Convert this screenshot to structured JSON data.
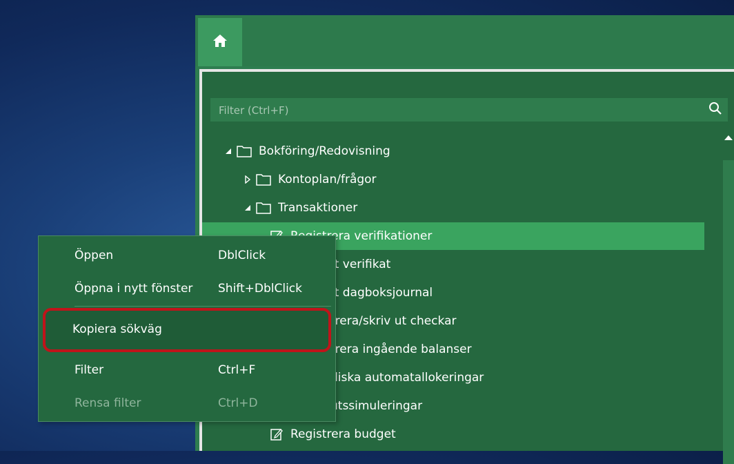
{
  "filter": {
    "placeholder": "Filter (Ctrl+F)"
  },
  "tree": [
    {
      "label": "Bokföring/Redovisning",
      "expanded": true,
      "icon": "folder-icon"
    },
    {
      "label": "Kontoplan/frågor",
      "expanded": false,
      "icon": "folder-icon"
    },
    {
      "label": "Transaktioner",
      "expanded": true,
      "icon": "folder-icon"
    },
    {
      "label": "Registrera verifikationer",
      "icon": "edit-icon",
      "selected": true
    },
    {
      "label": "ft verifikat",
      "icon": "edit-icon"
    },
    {
      "label": "ft dagboksjournal",
      "icon": "edit-icon"
    },
    {
      "label": "trera/skriv ut checkar",
      "icon": "edit-icon"
    },
    {
      "label": "trera ingående balanser",
      "icon": "edit-icon"
    },
    {
      "label": "diska automatallokeringar",
      "icon": "edit-icon"
    },
    {
      "label": "utssimuleringar",
      "icon": "edit-icon"
    },
    {
      "label": "Registrera budget",
      "icon": "edit-icon"
    }
  ],
  "context_menu": {
    "items": [
      {
        "label": "Öppen",
        "shortcut": "DblClick"
      },
      {
        "label": "Öppna i nytt fönster",
        "shortcut": "Shift+DblClick"
      },
      {
        "label": "Kopiera sökväg",
        "shortcut": ""
      },
      {
        "label": "Filter",
        "shortcut": "Ctrl+F"
      },
      {
        "label": "Rensa filter",
        "shortcut": "Ctrl+D",
        "disabled": true
      }
    ]
  },
  "colors": {
    "accent_green": "#3aa45f",
    "panel_green": "#25683f",
    "highlight_red": "#c0141a"
  },
  "icons": {
    "home": "home-icon",
    "search": "search-icon"
  }
}
